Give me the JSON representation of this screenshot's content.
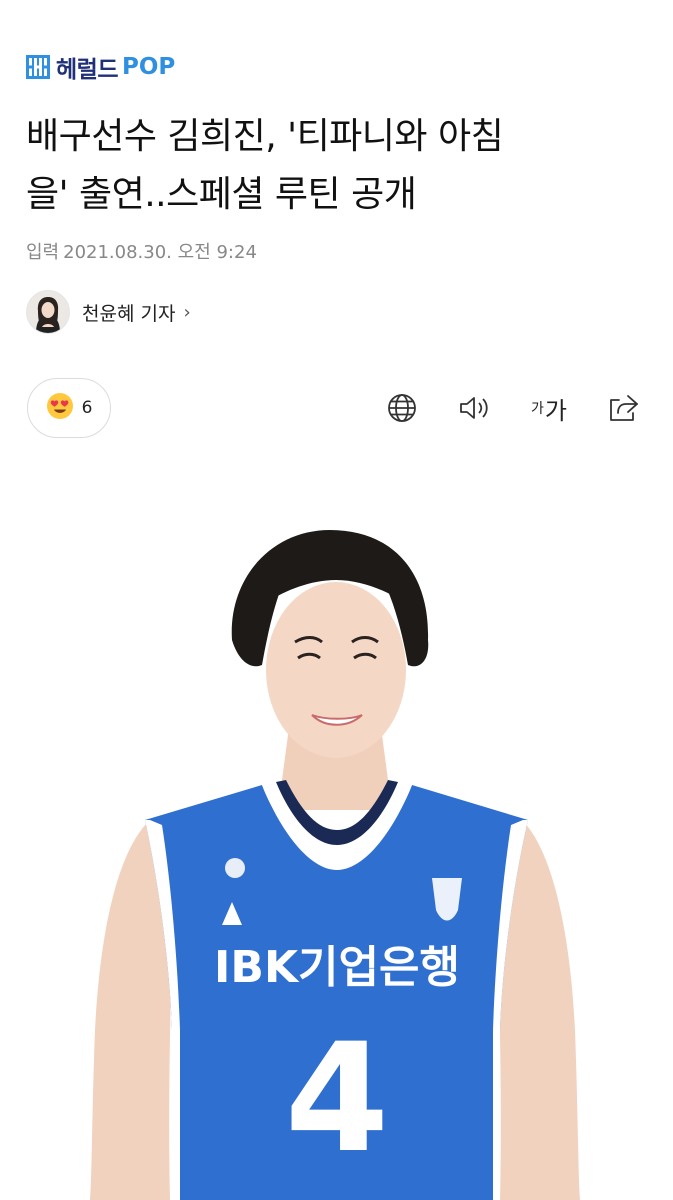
{
  "brand": {
    "name": "헤럴드",
    "suffix": "POP",
    "colors": {
      "navy": "#1f2f78",
      "blue": "#2f8fe0"
    }
  },
  "article": {
    "title_line1": "배구선수 김희진, '티파니와 아침",
    "title_line2": "을' 출연..스페셜 루틴 공개",
    "date_label": "입력",
    "date_value": "2021.08.30. 오전 9:24",
    "reporter": "천윤혜 기자",
    "reporter_chevron": "›"
  },
  "reaction": {
    "icon": "heart-eyes-emoji",
    "count": "6"
  },
  "toolbar": {
    "translate_icon": "globe-icon",
    "audio_icon": "speaker-icon",
    "font_small": "가",
    "font_large": "가",
    "share_icon": "share-icon"
  },
  "photo": {
    "jersey_sponsor": "IBK기업은행",
    "jersey_number": "4",
    "jersey_colors": {
      "primary": "#2f6fd0",
      "trim": "#ffffff",
      "neck": "#1b2a55"
    }
  }
}
